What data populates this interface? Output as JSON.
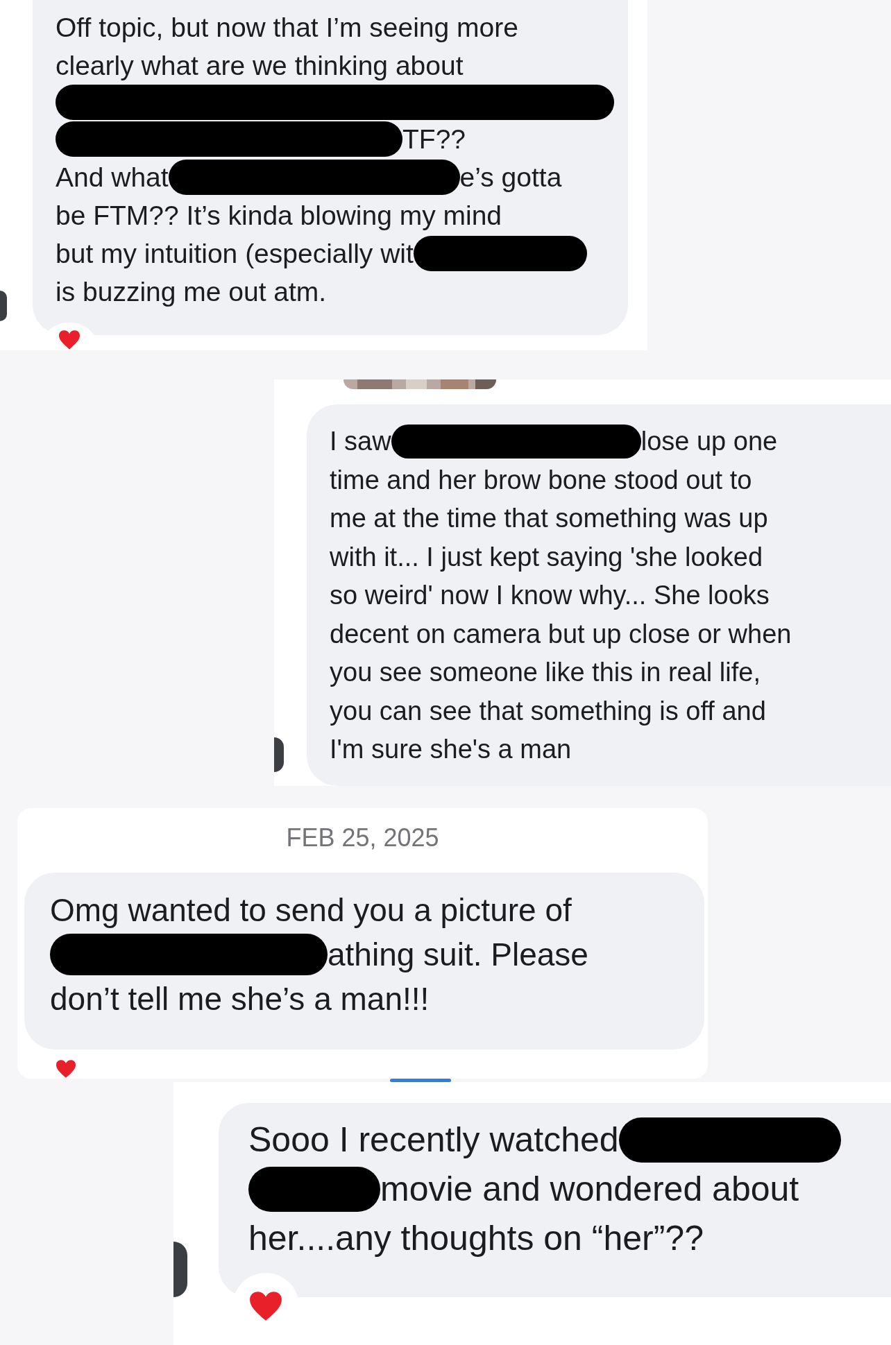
{
  "panels": [
    {
      "avatar": true,
      "reacted": true,
      "message": {
        "lines": [
          [
            {
              "kind": "text",
              "text": "Off topic, but now that I’m seeing more"
            }
          ],
          [
            {
              "kind": "text",
              "text": "clearly what are we thinking about"
            }
          ],
          [
            {
              "kind": "redaction"
            }
          ],
          [
            {
              "kind": "redaction"
            },
            {
              "kind": "text",
              "text": "TF??"
            }
          ],
          [
            {
              "kind": "text",
              "text": "And what"
            },
            {
              "kind": "redaction"
            },
            {
              "kind": "text",
              "text": "e’s gotta"
            }
          ],
          [
            {
              "kind": "text",
              "text": "be FTM?? It’s kinda blowing my mind"
            }
          ],
          [
            {
              "kind": "text",
              "text": "but my intuition (especially wit"
            },
            {
              "kind": "redaction"
            }
          ],
          [
            {
              "kind": "text",
              "text": "is buzzing me out atm."
            }
          ]
        ]
      }
    },
    {
      "avatar": true,
      "photo": true,
      "message": {
        "lines": [
          [
            {
              "kind": "text",
              "text": "I saw"
            },
            {
              "kind": "redaction"
            },
            {
              "kind": "text",
              "text": "lose up one"
            }
          ],
          [
            {
              "kind": "text",
              "text": "time and her brow bone stood out to"
            }
          ],
          [
            {
              "kind": "text",
              "text": "me at the time that something was up"
            }
          ],
          [
            {
              "kind": "text",
              "text": "with it... I just kept saying 'she looked"
            }
          ],
          [
            {
              "kind": "text",
              "text": "so weird' now I know why... She looks"
            }
          ],
          [
            {
              "kind": "text",
              "text": "decent on camera but up close or when"
            }
          ],
          [
            {
              "kind": "text",
              "text": "you see someone like this in real life,"
            }
          ],
          [
            {
              "kind": "text",
              "text": "you can see that something is off and"
            }
          ],
          [
            {
              "kind": "text",
              "text": "I'm sure she's a man"
            }
          ]
        ]
      }
    },
    {
      "date": "FEB 25, 2025",
      "reacted": true,
      "message": {
        "lines": [
          [
            {
              "kind": "text",
              "text": "Omg wanted to send you a picture of"
            }
          ],
          [
            {
              "kind": "redaction"
            },
            {
              "kind": "text",
              "text": "athing suit. Please"
            }
          ],
          [
            {
              "kind": "text",
              "text": "don’t tell me she’s a man!!!"
            }
          ]
        ]
      }
    },
    {
      "avatar": true,
      "reacted": true,
      "message": {
        "lines": [
          [
            {
              "kind": "text",
              "text": "Sooo I recently watched"
            },
            {
              "kind": "redaction"
            }
          ],
          [
            {
              "kind": "redaction"
            },
            {
              "kind": "text",
              "text": "movie and wondered about"
            }
          ],
          [
            {
              "kind": "text",
              "text": "her....any thoughts on “her”??"
            }
          ]
        ]
      }
    }
  ]
}
